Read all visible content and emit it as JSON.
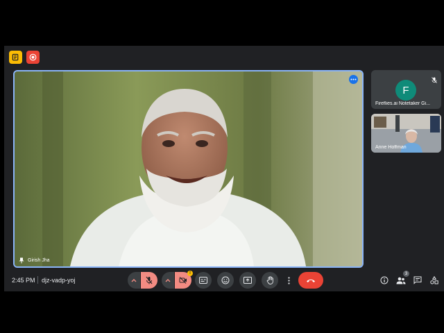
{
  "main_tile": {
    "participant_name": "Girish Jha"
  },
  "side_tiles": [
    {
      "avatar_letter": "F",
      "participant_name": "Fireflies.ai Notetaker Gi..."
    },
    {
      "participant_name": "Anne Hoffman"
    }
  ],
  "bottom_bar": {
    "time": "2:45 PM",
    "meeting_code": "djz-vadp-yoj",
    "people_count": "3",
    "camera_warning": "!"
  },
  "colors": {
    "accent": "#8ab4f8",
    "danger": "#ea4335",
    "muted_button": "#f28b82",
    "bar_bg": "#202124"
  }
}
